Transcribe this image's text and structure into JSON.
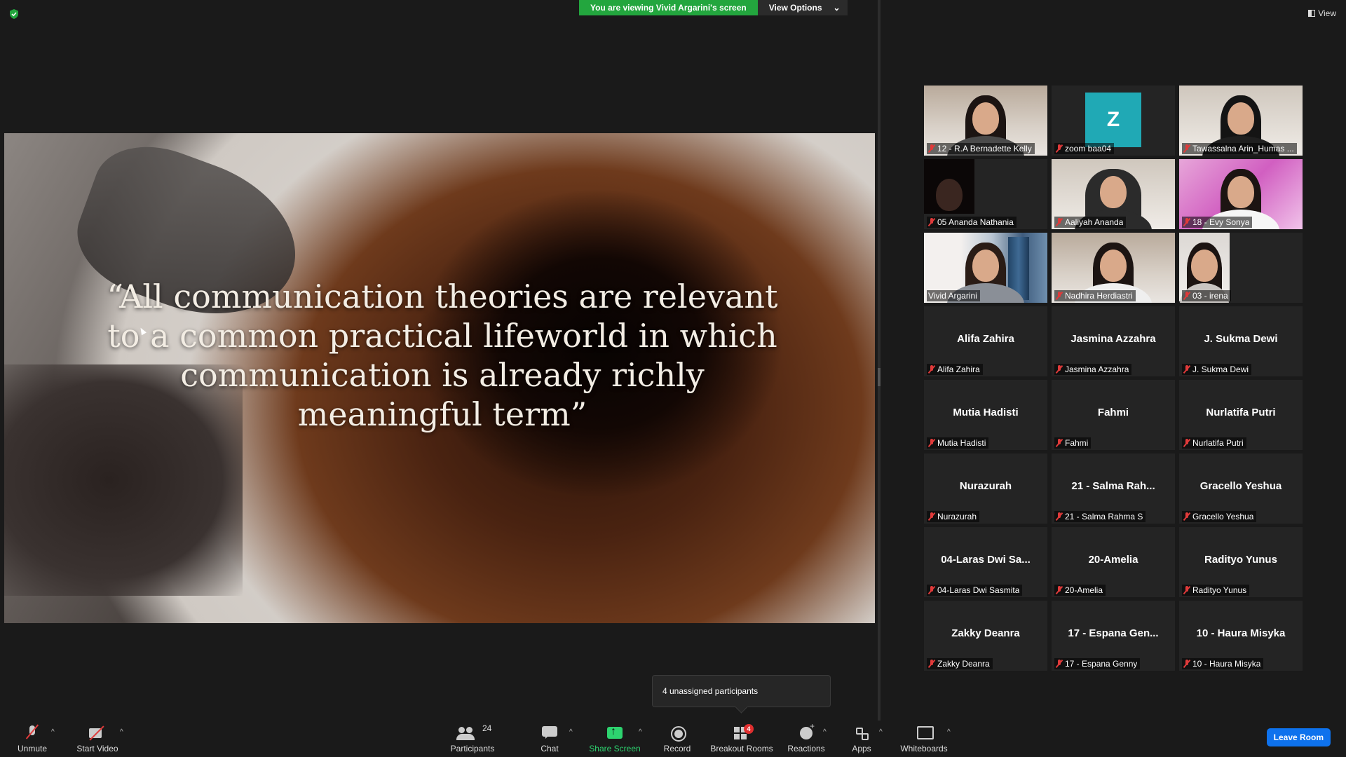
{
  "top": {
    "viewing_banner": "You are viewing Vivid Argarini's screen",
    "view_options": "View Options",
    "view_label": "View"
  },
  "slide": {
    "quote": "“All communication theories are relevant to a common practical lifeworld in which communication is already richly meaningful term”"
  },
  "gallery": {
    "tiles": [
      {
        "label": "12 - R.A Bernadette Kelly",
        "big": ""
      },
      {
        "label": "zoom baa04",
        "big": "",
        "avatar_letter": "Z"
      },
      {
        "label": "Tawassalna Arin_Humas ...",
        "big": ""
      },
      {
        "label": "05 Ananda Nathania",
        "big": ""
      },
      {
        "label": "Aaliyah Ananda",
        "big": ""
      },
      {
        "label": "18 - Evy Sonya",
        "big": ""
      },
      {
        "label": "Vivid Argarini",
        "big": ""
      },
      {
        "label": "Nadhira Herdiastri",
        "big": ""
      },
      {
        "label": "03 - irena",
        "big": ""
      },
      {
        "label": "Alifa Zahira",
        "big": "Alifa Zahira"
      },
      {
        "label": "Jasmina Azzahra",
        "big": "Jasmina Azzahra"
      },
      {
        "label": "J. Sukma Dewi",
        "big": "J. Sukma Dewi"
      },
      {
        "label": "Mutia Hadisti",
        "big": "Mutia Hadisti"
      },
      {
        "label": "Fahmi",
        "big": "Fahmi"
      },
      {
        "label": "Nurlatifa Putri",
        "big": "Nurlatifa Putri"
      },
      {
        "label": "Nurazurah",
        "big": "Nurazurah"
      },
      {
        "label": "21 - Salma Rahma S",
        "big": "21 - Salma Rah..."
      },
      {
        "label": "Gracello Yeshua",
        "big": "Gracello Yeshua"
      },
      {
        "label": "04-Laras Dwi Sasmita",
        "big": "04-Laras Dwi Sa..."
      },
      {
        "label": "20-Amelia",
        "big": "20-Amelia"
      },
      {
        "label": "Radityo Yunus",
        "big": "Radityo Yunus"
      },
      {
        "label": "Zakky Deanra",
        "big": "Zakky Deanra"
      },
      {
        "label": "17 - Espana Genny",
        "big": "17 - Espana Gen..."
      },
      {
        "label": "10 - Haura Misyka",
        "big": "10 - Haura Misyka"
      }
    ]
  },
  "tooltip": {
    "unassigned": "4 unassigned participants"
  },
  "toolbar": {
    "unmute": "Unmute",
    "start_video": "Start Video",
    "participants": "Participants",
    "participants_count": "24",
    "chat": "Chat",
    "share_screen": "Share Screen",
    "record": "Record",
    "breakout_rooms": "Breakout Rooms",
    "breakout_badge": "4",
    "reactions": "Reactions",
    "apps": "Apps",
    "whiteboards": "Whiteboards",
    "leave_room": "Leave Room"
  },
  "colors": {
    "banner_green": "#23a63e",
    "share_green": "#2dd36f",
    "active_speaker": "#f2e84f",
    "leave_blue": "#0e72ed",
    "muted_red": "#e03a3a"
  }
}
